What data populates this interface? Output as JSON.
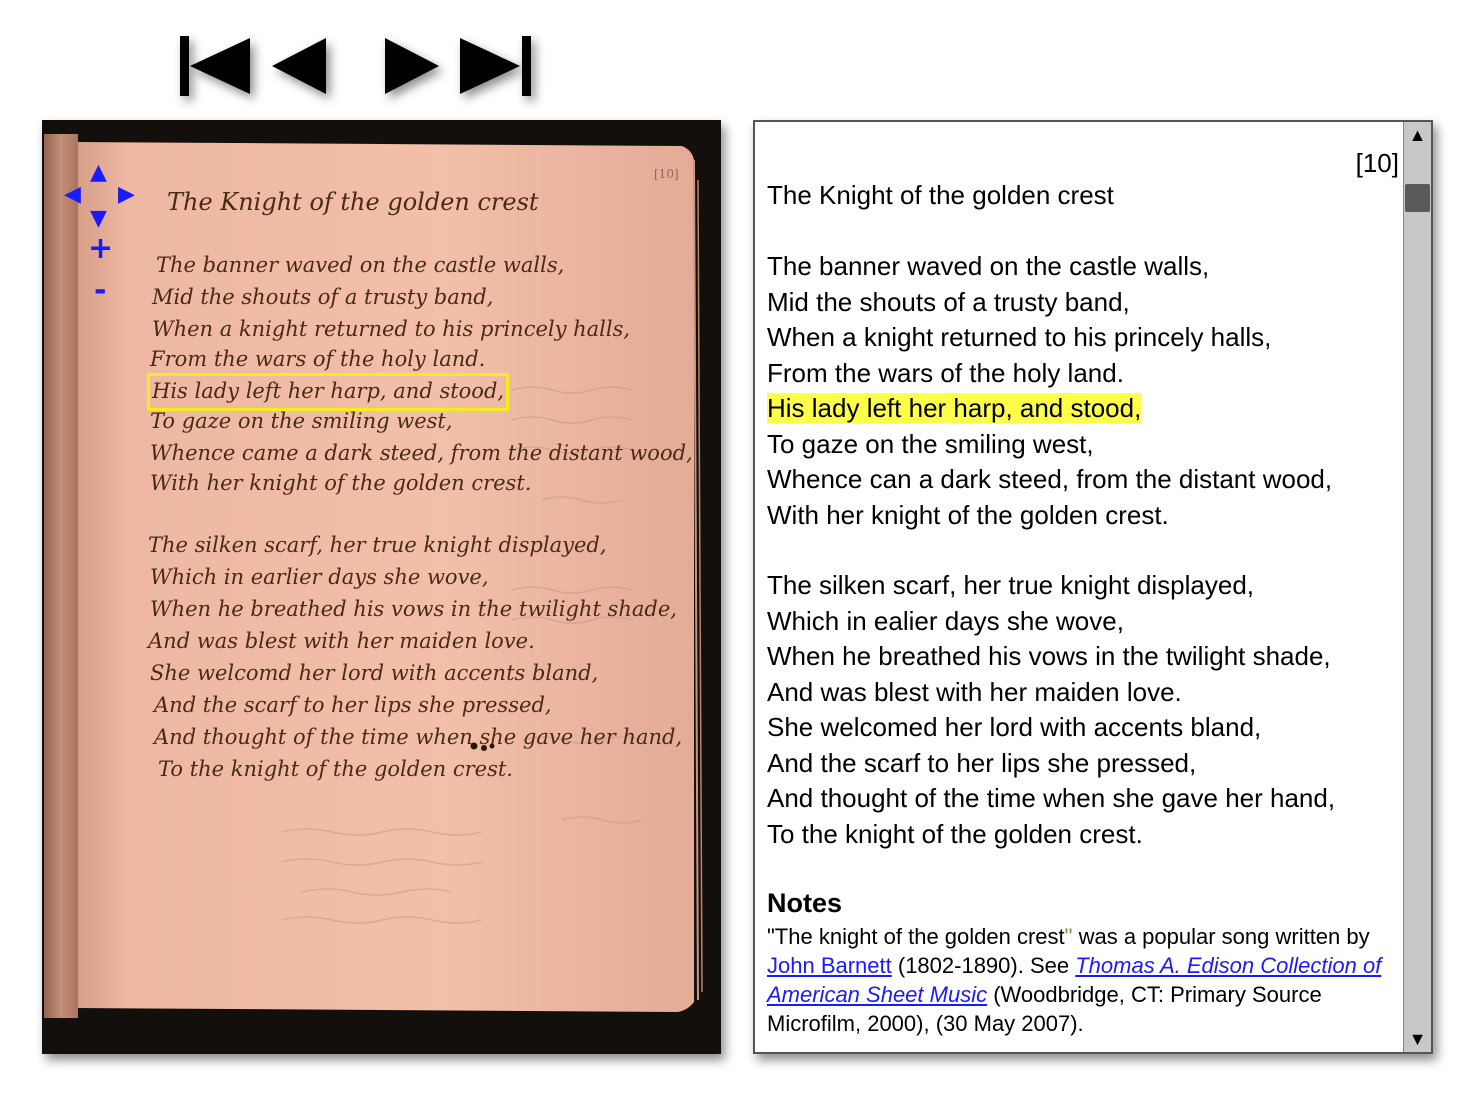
{
  "navigation": {
    "first_icon": "skip-to-first-icon",
    "prev_icon": "previous-icon",
    "next_icon": "next-icon",
    "last_icon": "skip-to-last-icon"
  },
  "viewer": {
    "controls": {
      "pan_up": "▲",
      "pan_left": "◀",
      "pan_right": "▶",
      "pan_down": "▼",
      "zoom_in": "+",
      "zoom_out": "-"
    },
    "highlight_color": "#f2ee1e",
    "page_color": "#efb9a4",
    "ink_color": "#4a2a14"
  },
  "transcription": {
    "page_number": "[10]",
    "title": "The Knight of the golden crest",
    "stanzas": [
      [
        "The banner waved on the castle walls,",
        "Mid the shouts of a trusty band,",
        "When a knight returned to his princely halls,",
        "From the wars of the holy land.",
        "His lady left her harp, and stood,",
        "To gaze on the smiling west,",
        "Whence can a dark steed, from the distant wood,",
        "With her knight of the golden crest."
      ],
      [
        "The silken scarf, her true knight displayed,",
        "Which in ealier days she wove,",
        "When he breathed his vows in the twilight shade,",
        "And was blest with her maiden love.",
        "She welcomed her lord with accents bland,",
        "And the scarf to her lips she pressed,",
        "And thought of the time when she gave her hand,",
        "To the knight of the golden crest."
      ]
    ],
    "highlighted_line": "His lady left her harp, and stood,",
    "highlight_color": "#ffff4a",
    "notes": {
      "heading": "Notes",
      "text_1": "\"The knight of the golden crest",
      "text_quote": "\"",
      "text_2": " was a popular song written by ",
      "link_author": "John Barnett",
      "text_3": " (1802-1890). See ",
      "link_collection": "Thomas A. Edison Collection of American Sheet Music",
      "text_4": " (Woodbridge, CT: Primary Source Microfilm, 2000), (30 May 2007)."
    },
    "scrollbar": {
      "up_icon": "▲",
      "down_icon": "▼"
    }
  }
}
